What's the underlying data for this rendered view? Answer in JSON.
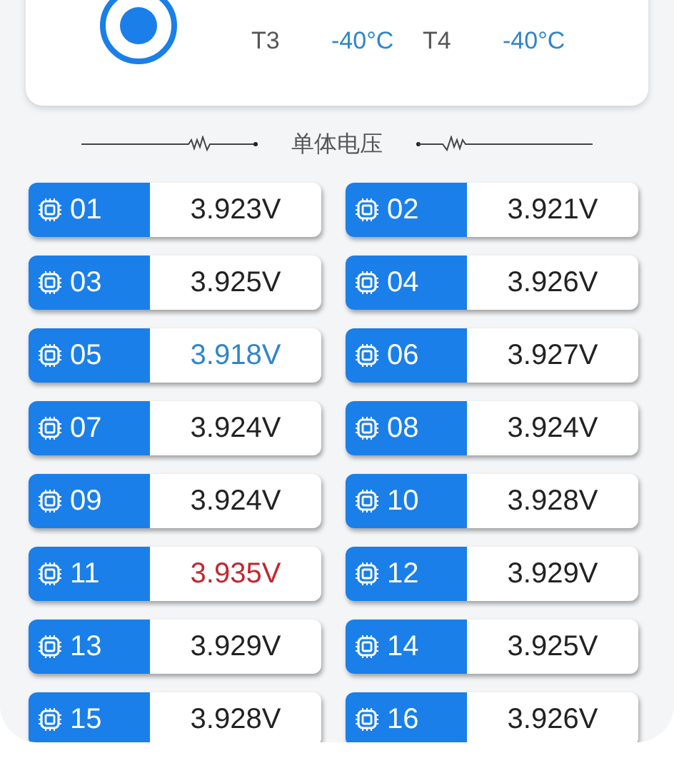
{
  "temperatures": [
    {
      "label": "T3",
      "value": "-40°C"
    },
    {
      "label": "T4",
      "value": "-40°C"
    }
  ],
  "section_title": "单体电压",
  "cells": [
    {
      "number": "01",
      "voltage": "3.923V",
      "color": "#222222"
    },
    {
      "number": "02",
      "voltage": "3.921V",
      "color": "#222222"
    },
    {
      "number": "03",
      "voltage": "3.925V",
      "color": "#222222"
    },
    {
      "number": "04",
      "voltage": "3.926V",
      "color": "#222222"
    },
    {
      "number": "05",
      "voltage": "3.918V",
      "color": "#2f86c8"
    },
    {
      "number": "06",
      "voltage": "3.927V",
      "color": "#222222"
    },
    {
      "number": "07",
      "voltage": "3.924V",
      "color": "#222222"
    },
    {
      "number": "08",
      "voltage": "3.924V",
      "color": "#222222"
    },
    {
      "number": "09",
      "voltage": "3.924V",
      "color": "#222222"
    },
    {
      "number": "10",
      "voltage": "3.928V",
      "color": "#222222"
    },
    {
      "number": "11",
      "voltage": "3.935V",
      "color": "#c0282e"
    },
    {
      "number": "12",
      "voltage": "3.929V",
      "color": "#222222"
    },
    {
      "number": "13",
      "voltage": "3.929V",
      "color": "#222222"
    },
    {
      "number": "14",
      "voltage": "3.925V",
      "color": "#222222"
    },
    {
      "number": "15",
      "voltage": "3.928V",
      "color": "#222222"
    },
    {
      "number": "16",
      "voltage": "3.926V",
      "color": "#222222"
    }
  ]
}
